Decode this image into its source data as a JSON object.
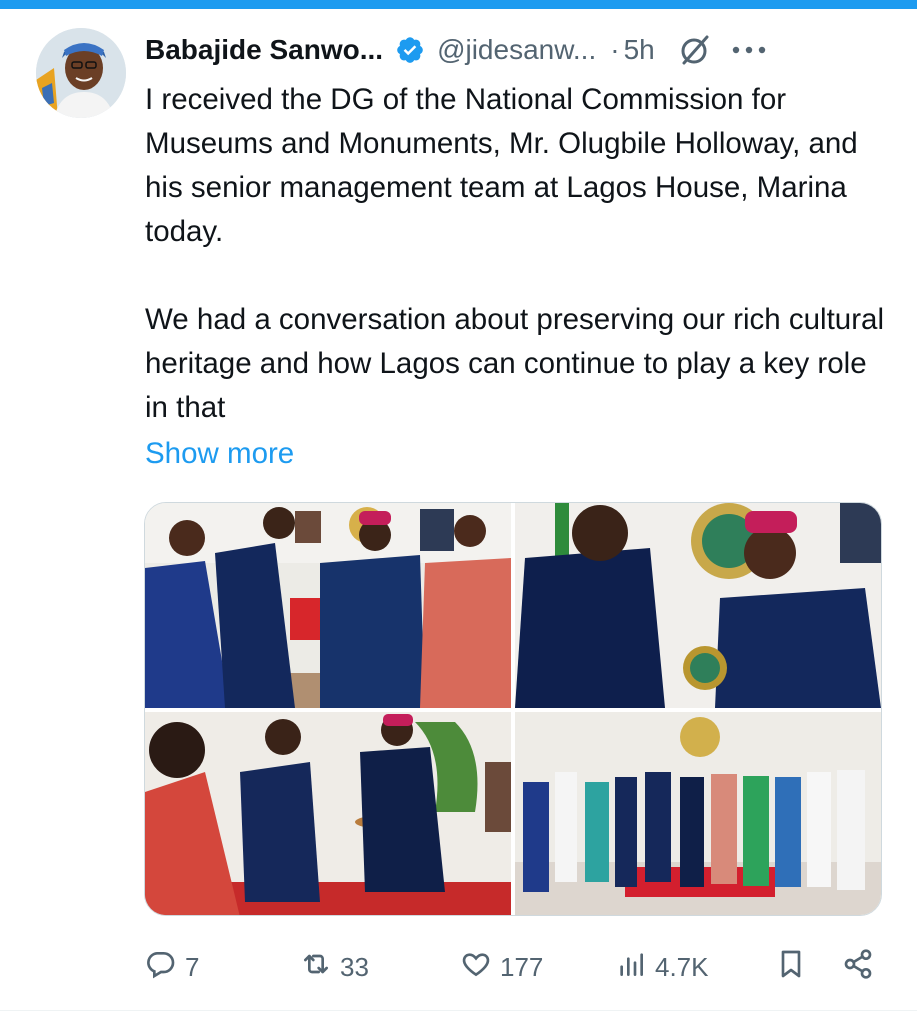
{
  "tweet": {
    "author_name": "Babajide Sanwo...",
    "handle": "@jidesanw...",
    "separator": "·",
    "time": "5h",
    "text": "I received the DG of the National Commission for Museums and Monuments, Mr. Olugbile Holloway, and his senior management team at Lagos House, Marina today.\n\nWe had a conversation about preserving our rich cultural heritage and how Lagos can continue to play a key role in that",
    "show_more": "Show more"
  },
  "actions": {
    "replies": "7",
    "retweets": "33",
    "likes": "177",
    "views": "4.7K"
  },
  "icons": {
    "verified": "verified-badge-icon",
    "grok": "grok-icon",
    "more": "more-options-icon",
    "reply": "reply-icon",
    "retweet": "retweet-icon",
    "like": "heart-icon",
    "views": "views-bar-chart-icon",
    "bookmark": "bookmark-icon",
    "share": "share-icon"
  },
  "colors": {
    "accent": "#1d9bf0",
    "text": "#0f1419",
    "muted": "#536471"
  }
}
